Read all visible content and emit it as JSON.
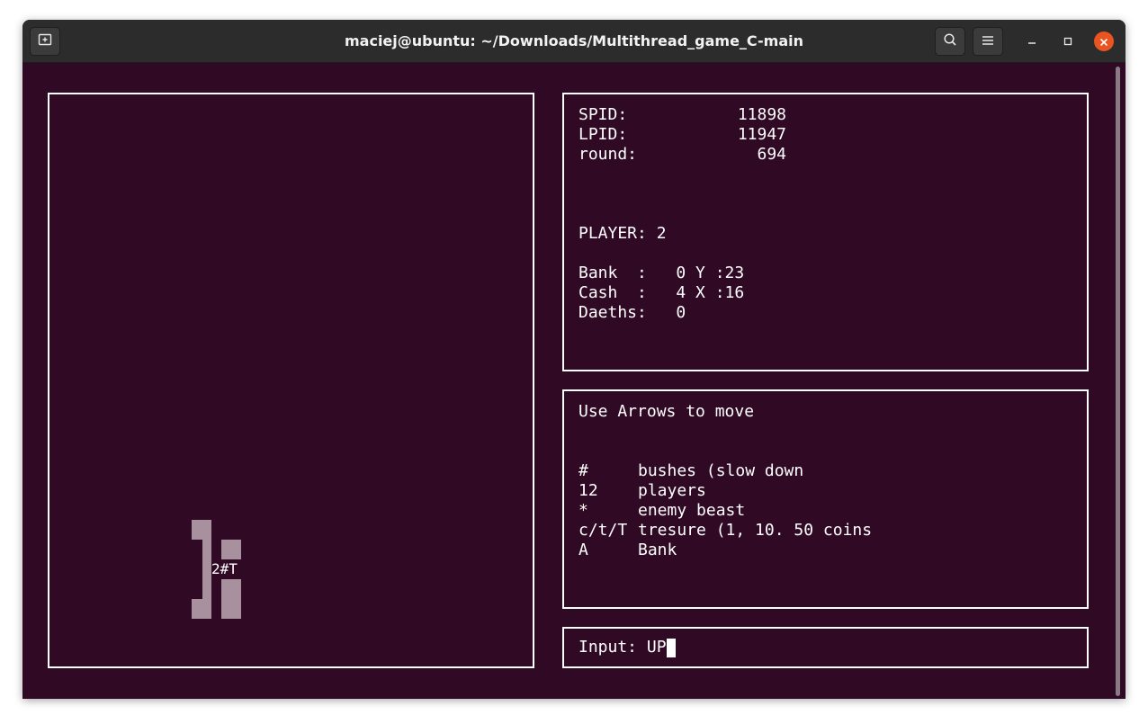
{
  "window": {
    "title": "maciej@ubuntu: ~/Downloads/Multithread_game_C-main"
  },
  "titlebar_icons": {
    "new_tab": "new-tab-icon",
    "search": "search-icon",
    "menu": "hamburger-menu-icon",
    "minimize": "minimize-icon",
    "maximize": "maximize-icon",
    "close": "close-icon"
  },
  "colors": {
    "terminal_bg": "#300a24",
    "titlebar_bg": "#2c2c2c",
    "close_button": "#e95420",
    "map_block": "#a8909f",
    "text": "#ffffff"
  },
  "map": {
    "label": "2#T"
  },
  "stats": {
    "spid_label": "SPID:",
    "spid_value": "11898",
    "lpid_label": "LPID:",
    "lpid_value": "11947",
    "round_label": "round:",
    "round_value": "694",
    "player_line": "PLAYER: 2",
    "bank_line": "Bank  :   0 Y :23",
    "cash_line": "Cash  :   4 X :16",
    "deaths_line": "Daeths:   0"
  },
  "legend": {
    "instruction": "Use Arrows to move",
    "items": [
      {
        "symbol": "#",
        "description": "bushes (slow down"
      },
      {
        "symbol": "12",
        "description": "players"
      },
      {
        "symbol": "*",
        "description": "enemy beast"
      },
      {
        "symbol": "c/t/T",
        "description": "tresure (1, 10. 50 coins"
      },
      {
        "symbol": "A",
        "description": "Bank"
      }
    ]
  },
  "input": {
    "label": "Input:",
    "value": "UP"
  }
}
